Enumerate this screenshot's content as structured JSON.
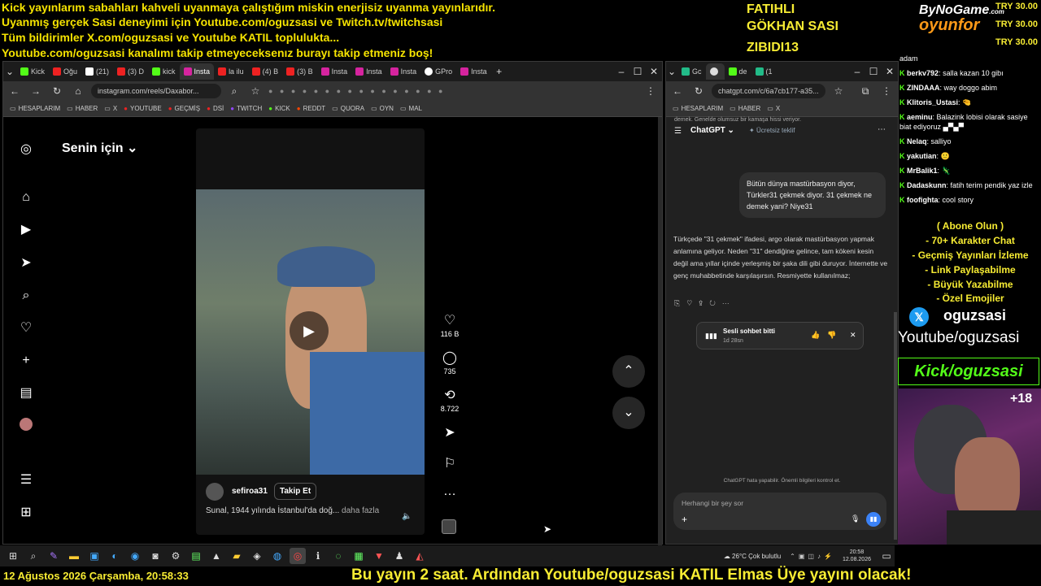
{
  "banner": {
    "lines": [
      "Kick yayınlarım sabahları kahveli uyanmaya çalıştığım miskin enerjisiz uyanma yayınlarıdır.",
      "Uyanmış gerçek Sasi deneyimi için Youtube.com/oguzsasi ve Twitch.tv/twitchsasi",
      "Tüm bildirimler X.com/oguzsasi ve Youtube KATIL toplulukta...",
      "Youtube.com/oguzsasi kanalımı takip etmeyeceksenız burayı takip etmeniz boş!"
    ],
    "names": [
      "FATIHLI",
      "GÖKHAN SASI",
      "ZIBIDI13"
    ],
    "logo_top": "ByNoGame",
    "logo_com": ".com",
    "logo_bottom": "oyunfor",
    "try": [
      "TRY 30.00",
      "TRY 30.00",
      "TRY 30.00"
    ]
  },
  "left_browser": {
    "tabs": [
      "Kick",
      "Oğu",
      "(21)",
      "(3) D",
      "kick",
      "Insta",
      "la ilu",
      "(4) B",
      "(3) B",
      "Insta",
      "Insta",
      "Insta",
      "GPro",
      "Insta"
    ],
    "url": "instagram.com/reels/Daxabor...",
    "bookmarks": [
      "HESAPLARIM",
      "HABER",
      "X",
      "YOUTUBE",
      "GEÇMİŞ",
      "DSİ",
      "TWITCH",
      "KICK",
      "REDDT",
      "QUORA",
      "OYN",
      "MAL"
    ],
    "header": "Senin için",
    "likes": "116 B",
    "comments": "735",
    "reposts": "8.722",
    "username": "sefiroa31",
    "follow_label": "Takip Et",
    "caption": "Sunal, 1944 yılında İstanbul'da doğ...",
    "more_label": "daha fazla"
  },
  "right_browser": {
    "tabs": [
      "Gc",
      "",
      "de",
      "(1"
    ],
    "url": "chatgpt.com/c/6a7cb177-a35...",
    "bookmarks": [
      "HESAPLARIM",
      "HABER",
      "X"
    ],
    "top_snippet": "demek. Genelde olumsuz bir kamaşa hissi veriyor.",
    "model": "ChatGPT",
    "offer": "Ücretsiz teklif",
    "user_message": "Bütün dünya mastürbasyon diyor, Türkler31 çekmek diyor. 31 çekmek ne demek yani? Niye31",
    "assistant_message": "Türkçede \"31 çekmek\" ifadesi, argo olarak mastürbasyon yapmak anlamına geliyor. Neden \"31\" dendiğine gelince, tam kökeni kesin değil ama yıllar içinde yerleşmiş bir şaka dili gibi duruyor. İnternette ve genç muhabbetinde karşılaşırsın. Resmiyette kullanılmaz;",
    "voice_title": "Sesli sohbet bitti",
    "voice_duration": "1d 28sn",
    "disclaimer": "ChatGPT hata yapabilir. Önemli bilgileri kontrol et.",
    "input_placeholder": "Herhangi bir şey sor"
  },
  "chat": {
    "messages": [
      {
        "user": "",
        "text": "adam"
      },
      {
        "user": "berkv792",
        "text": ": salla kazan 10 gibı"
      },
      {
        "user": "ZINDAAA",
        "text": ": way doggo abim"
      },
      {
        "user": "Klitoris_Ustasi",
        "text": ": 🤏"
      },
      {
        "user": "aeminu",
        "text": ": Balazink lobisi olarak sasiye biat ediyoruz ▄▀▄▀"
      },
      {
        "user": "Nelaq",
        "text": ": salliyo"
      },
      {
        "user": "yakutian",
        "text": ": 🙂"
      },
      {
        "user": "MrBalik1",
        "text": ": 🦎"
      },
      {
        "user": "Dadaskunn",
        "text": ": fatih terim pendik yaz izle"
      },
      {
        "user": "foofighta",
        "text": ": cool story"
      }
    ],
    "promo": [
      "( Abone Olun )",
      "- 70+ Karakter Chat",
      "- Geçmiş Yayınları İzleme",
      "- Link Paylaşabilme",
      "- Büyük Yazabilme",
      "- Özel Emojiler"
    ],
    "x_handle": "oguzsasi",
    "youtube_handle": "Youtube/oguzsasi",
    "kick_handle": "Kick/oguzsasi",
    "viewers": "+18"
  },
  "taskbar": {
    "weather": "26°C  Çok bulutlu",
    "time": "20:58",
    "date": "12.08.2026"
  },
  "bottom": {
    "datetime": "12 Ağustos 2026 Çarşamba, 20:58:33",
    "ticker": "Bu yayın 2 saat. Ardından Youtube/oguzsasi KATIL Elmas Üye yayını olacak!"
  }
}
